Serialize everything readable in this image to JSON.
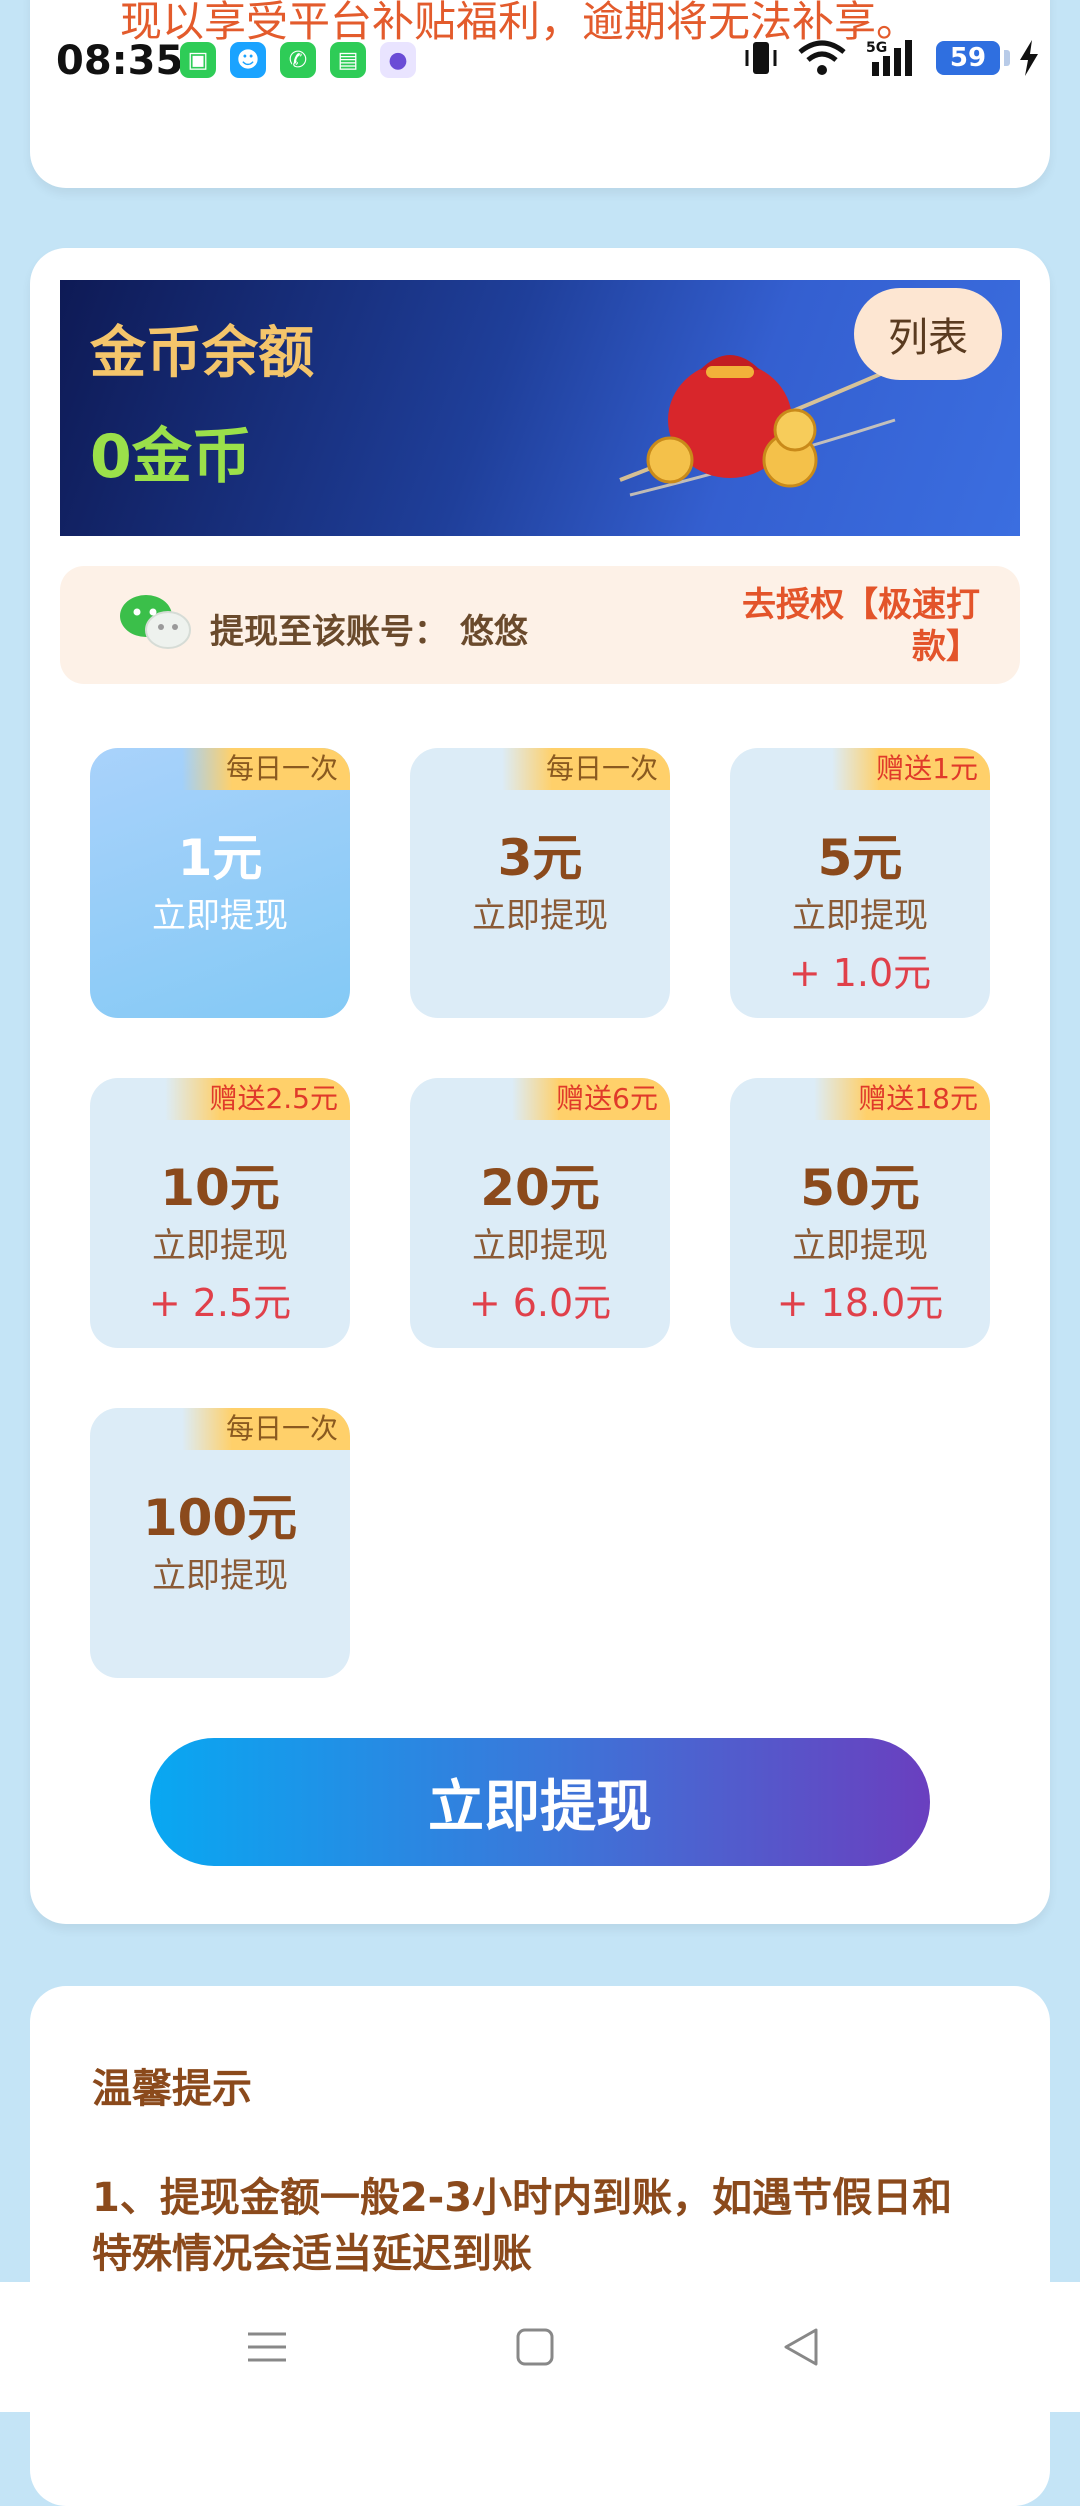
{
  "status_bar": {
    "time": "08:35",
    "battery": "59"
  },
  "top_card": {
    "notice": "现以享受平台补贴福利，逾期将无法补享。"
  },
  "banner": {
    "title": "金币余额",
    "value": "0金币",
    "list_button": "列表"
  },
  "account": {
    "label": "提现至该账号：",
    "name": "悠悠",
    "auth_link": "去授权【极速打款】"
  },
  "options": [
    {
      "tag": "每日一次",
      "tag_type": "daily",
      "amount": "1元",
      "label": "立即提现",
      "bonus": "",
      "selected": true
    },
    {
      "tag": "每日一次",
      "tag_type": "daily",
      "amount": "3元",
      "label": "立即提现",
      "bonus": "",
      "selected": false
    },
    {
      "tag": "赠送1元",
      "tag_type": "gift",
      "amount": "5元",
      "label": "立即提现",
      "bonus": "+ 1.0元",
      "selected": false
    },
    {
      "tag": "赠送2.5元",
      "tag_type": "gift",
      "amount": "10元",
      "label": "立即提现",
      "bonus": "+ 2.5元",
      "selected": false
    },
    {
      "tag": "赠送6元",
      "tag_type": "gift",
      "amount": "20元",
      "label": "立即提现",
      "bonus": "+ 6.0元",
      "selected": false
    },
    {
      "tag": "赠送18元",
      "tag_type": "gift",
      "amount": "50元",
      "label": "立即提现",
      "bonus": "+ 18.0元",
      "selected": false
    },
    {
      "tag": "每日一次",
      "tag_type": "daily",
      "amount": "100元",
      "label": "立即提现",
      "bonus": "",
      "selected": false
    }
  ],
  "cta": {
    "label": "立即提现"
  },
  "tips": {
    "title": "温馨提示",
    "item1": "1、提现金额一般2-3小时内到账，如遇节假日和特殊情况会适当延迟到账"
  },
  "colors": {
    "accent_gradient_start": "#08a8f2",
    "accent_gradient_end": "#6a3fbf",
    "gold": "#f4c56b",
    "balance_green": "#9be04a"
  }
}
